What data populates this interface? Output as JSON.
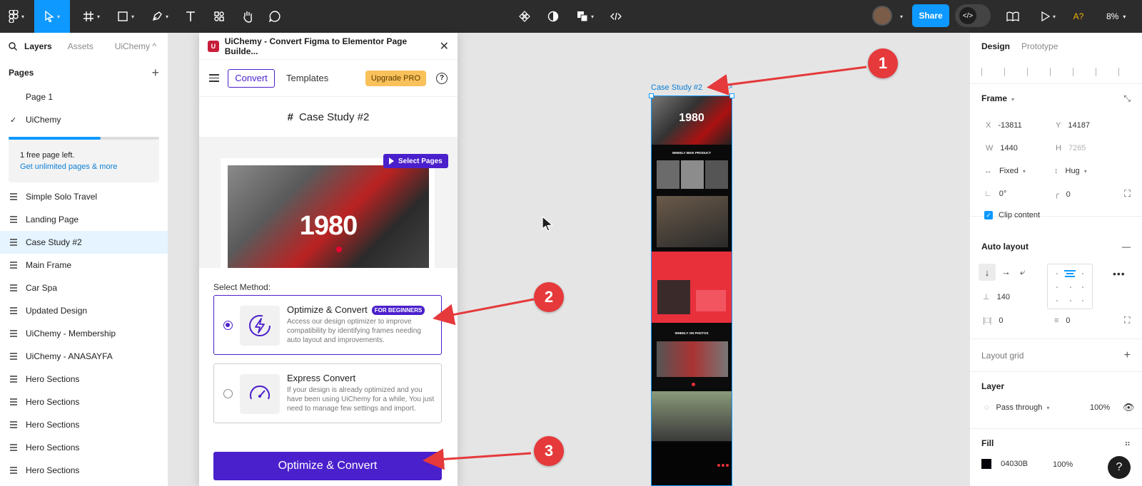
{
  "toolbar": {
    "share_label": "Share",
    "zoom_label": "8%"
  },
  "left_panel": {
    "tabs": {
      "layers": "Layers",
      "assets": "Assets",
      "plugin": "UiChemy ^"
    },
    "pages_title": "Pages",
    "pages": [
      {
        "label": "Page 1",
        "checked": false
      },
      {
        "label": "UiChemy",
        "checked": true
      }
    ],
    "promo": {
      "text": "1 free page left.",
      "link": "Get unlimited pages & more",
      "progress": 0.61
    },
    "layers": [
      {
        "label": "Simple Solo Travel",
        "selected": false
      },
      {
        "label": "Landing Page",
        "selected": false
      },
      {
        "label": "Case Study #2",
        "selected": true
      },
      {
        "label": "Main Frame",
        "selected": false
      },
      {
        "label": "Car Spa",
        "selected": false
      },
      {
        "label": "Updated Design",
        "selected": false
      },
      {
        "label": "UiChemy - Membership",
        "selected": false
      },
      {
        "label": "UiChemy - ANASAYFA",
        "selected": false
      },
      {
        "label": "Hero Sections",
        "selected": false
      },
      {
        "label": "Hero Sections",
        "selected": false
      },
      {
        "label": "Hero Sections",
        "selected": false
      },
      {
        "label": "Hero Sections",
        "selected": false
      },
      {
        "label": "Hero Sections",
        "selected": false
      }
    ]
  },
  "plugin": {
    "title": "UiChemy - Convert Figma to Elementor Page Builde...",
    "logo_letter": "U",
    "nav": {
      "convert": "Convert",
      "templates": "Templates",
      "upgrade": "Upgrade PRO",
      "help": "?"
    },
    "frame_title": "Case Study #2",
    "select_pages_label": "Select Pages",
    "preview_big_text": "1980",
    "method_label": "Select Method:",
    "options": [
      {
        "title": "Optimize & Convert",
        "badge": "FOR BEGINNERS",
        "desc": "Access our design optimizer to improve compatibility by identifying frames needing auto layout and improvements.",
        "selected": true,
        "icon": "lightning-icon"
      },
      {
        "title": "Express Convert",
        "badge": "",
        "desc": "If your design is already optimized and you have been using UiChemy for a while, You just need to manage few settings and import.",
        "selected": false,
        "icon": "speedometer-icon"
      }
    ],
    "cta_label": "Optimize & Convert"
  },
  "canvas": {
    "frame_label": "Case Study #2",
    "frame_dev_label": "</>",
    "frame_hero_text": "1980",
    "section_title_1": "WHEELY BIKE PRODUCT",
    "section_title_2": "WHEELY ON PHOTOS"
  },
  "right_panel": {
    "tabs": {
      "design": "Design",
      "prototype": "Prototype"
    },
    "frame_title": "Frame",
    "x": "-13811",
    "y": "14187",
    "w": "1440",
    "h": "7265",
    "width_mode": "Fixed",
    "height_mode": "Hug",
    "rotation": "0°",
    "radius": "0",
    "clip_content": "Clip content",
    "auto_layout_title": "Auto layout",
    "gap": "140",
    "padding_h": "0",
    "padding_v": "0",
    "layout_grid_title": "Layout grid",
    "layer_title": "Layer",
    "blend": "Pass through",
    "opacity": "100%",
    "fill_title": "Fill",
    "fill_hex": "04030B",
    "fill_opacity": "100%"
  },
  "annotations": [
    "1",
    "2",
    "3"
  ],
  "colors": {
    "accent": "#4a1fcc",
    "figma_blue": "#0d99ff",
    "annotation_red": "#e5393b",
    "upgrade": "#f9c15a"
  }
}
